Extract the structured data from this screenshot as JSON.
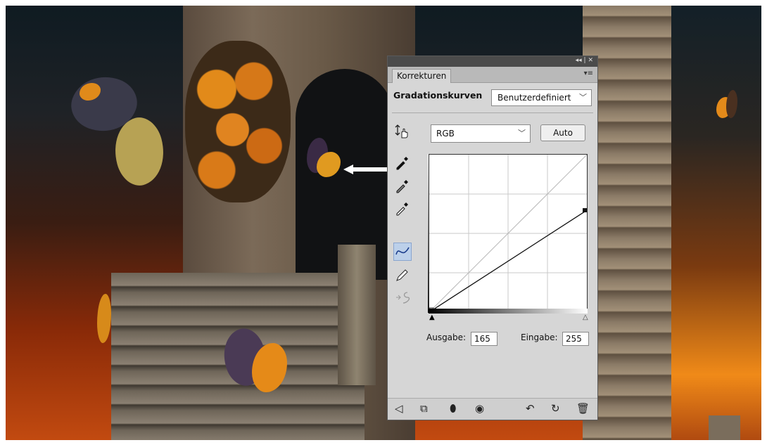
{
  "panel": {
    "title_controls": "◂◂ | ✕",
    "tab_label": "Korrekturen",
    "menu_icon": "▾≡",
    "adjustment_name": "Gradationskurven",
    "preset_value": "Benutzerdefiniert",
    "channel_value": "RGB",
    "auto_label": "Auto",
    "output_label": "Ausgabe:",
    "output_value": "165",
    "input_label": "Eingabe:",
    "input_value": "255",
    "curve_points": [
      [
        0,
        0
      ],
      [
        255,
        165
      ]
    ],
    "tools": [
      "on-image-adjust-icon",
      "black-point-eyedropper-icon",
      "gray-point-eyedropper-icon",
      "white-point-eyedropper-icon",
      "curve-edit-icon",
      "pencil-draw-icon",
      "smooth-curve-icon"
    ],
    "bottom_icons": [
      "back-arrow-icon",
      "clip-to-layer-icon",
      "layer-visibility-icon",
      "view-previous-icon",
      "reset-icon",
      "undo-icon",
      "delete-icon"
    ]
  },
  "colors": {
    "panel_bg": "#d6d6d6",
    "active_tool": "#bcd0ea",
    "titlebar": "#4b4b4b"
  }
}
